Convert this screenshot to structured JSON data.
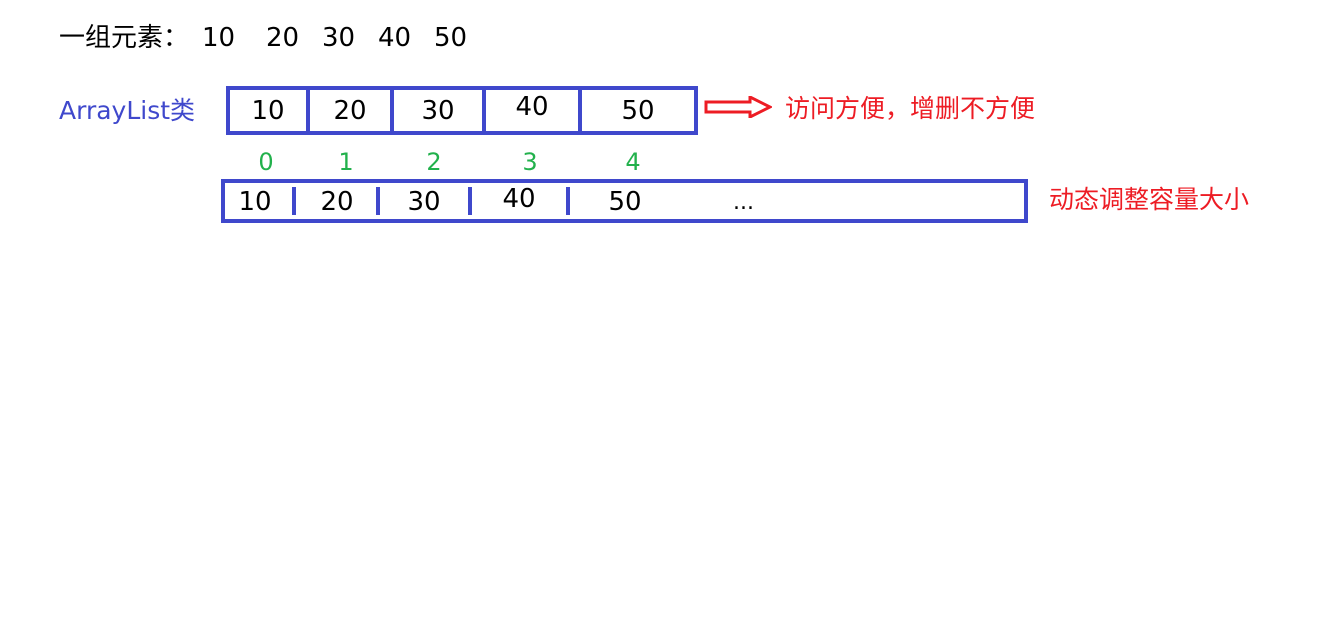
{
  "header": {
    "label": "一组元素：",
    "values": [
      "10",
      "20",
      "30",
      "40",
      "50"
    ]
  },
  "class_label": "ArrayList类",
  "fixed_array": {
    "cells": [
      "10",
      "20",
      "30",
      "40",
      "50"
    ]
  },
  "arrow_note": "访问方便，增删不方便",
  "indices": [
    "0",
    "1",
    "2",
    "3",
    "4"
  ],
  "dynamic_array": {
    "cells": [
      "10",
      "20",
      "30",
      "40",
      "50"
    ],
    "ellipsis": "..."
  },
  "dynamic_note": "动态调整容量大小",
  "colors": {
    "box": "#3f48cc",
    "label": "#3f48cc",
    "note": "#ed1c24",
    "index": "#22b14c",
    "text": "#000000"
  },
  "icons": [
    "right-arrow-icon"
  ]
}
